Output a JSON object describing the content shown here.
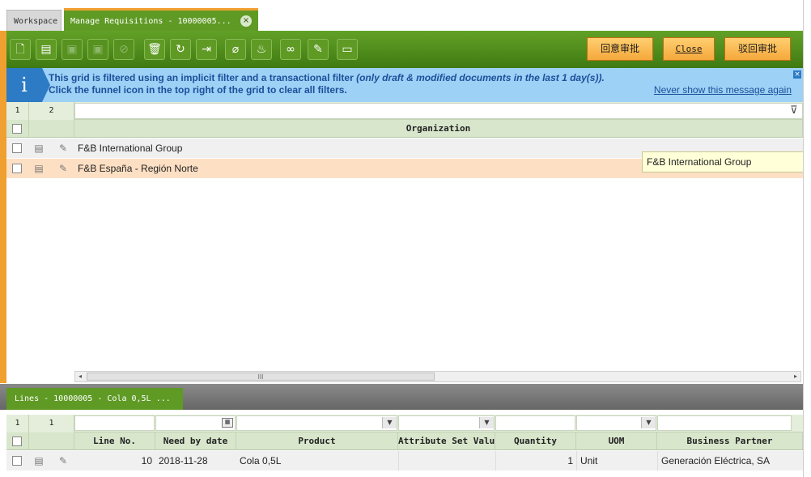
{
  "tabs": {
    "workspace": "Workspace",
    "manage": "Manage Requisitions - 10000005...",
    "close": "×"
  },
  "toolbar": {
    "icons": [
      "new-document-icon",
      "new-record-icon",
      "save-icon",
      "cancel-save-icon",
      "cancel-icon",
      "delete-icon",
      "refresh-icon",
      "export-icon",
      "attachment-icon",
      "audit-trail-icon",
      "link-icon",
      "tools-icon",
      "grid-view-icon"
    ],
    "buttons": {
      "reapprove": "回意审批",
      "close": "Close",
      "reject": "驳回审批"
    }
  },
  "banner": {
    "line1_prefix": "This grid is filtered using an implicit filter and a transactional filter ",
    "line1_italic": "(only draft & modified documents in the last 1 day(s)).",
    "line2": "Click the funnel icon in the top right of the grid to clear all filters.",
    "never_show": "Never show this message again",
    "icon": "i"
  },
  "upper_grid": {
    "pager_page": "1",
    "pager_count": "2",
    "column_header": "Organization",
    "rows": [
      {
        "organization": "F&B International Group"
      },
      {
        "organization": "F&B España - Región Norte"
      }
    ],
    "tooltip": "F&B International Group",
    "scroll_grip": "III"
  },
  "lines": {
    "tab_label": "Lines - 10000005 - Cola 0,5L ...",
    "pager_page": "1",
    "pager_count": "1",
    "columns": [
      "Line No.",
      "Need by date",
      "Product",
      "Attribute Set Value",
      "Quantity",
      "UOM",
      "Business Partner"
    ],
    "rows": [
      {
        "line_no": "10",
        "need_by_date": "2018-11-28",
        "product": "Cola 0,5L",
        "attribute_set_value": "",
        "quantity": "1",
        "uom": "Unit",
        "business_partner": "Generación Eléctrica, SA"
      }
    ]
  },
  "colors": {
    "accent_green": "#5f9a25",
    "accent_orange": "#f0a030",
    "banner_blue": "#9dd1f5",
    "selected_row": "#fde0c4"
  }
}
